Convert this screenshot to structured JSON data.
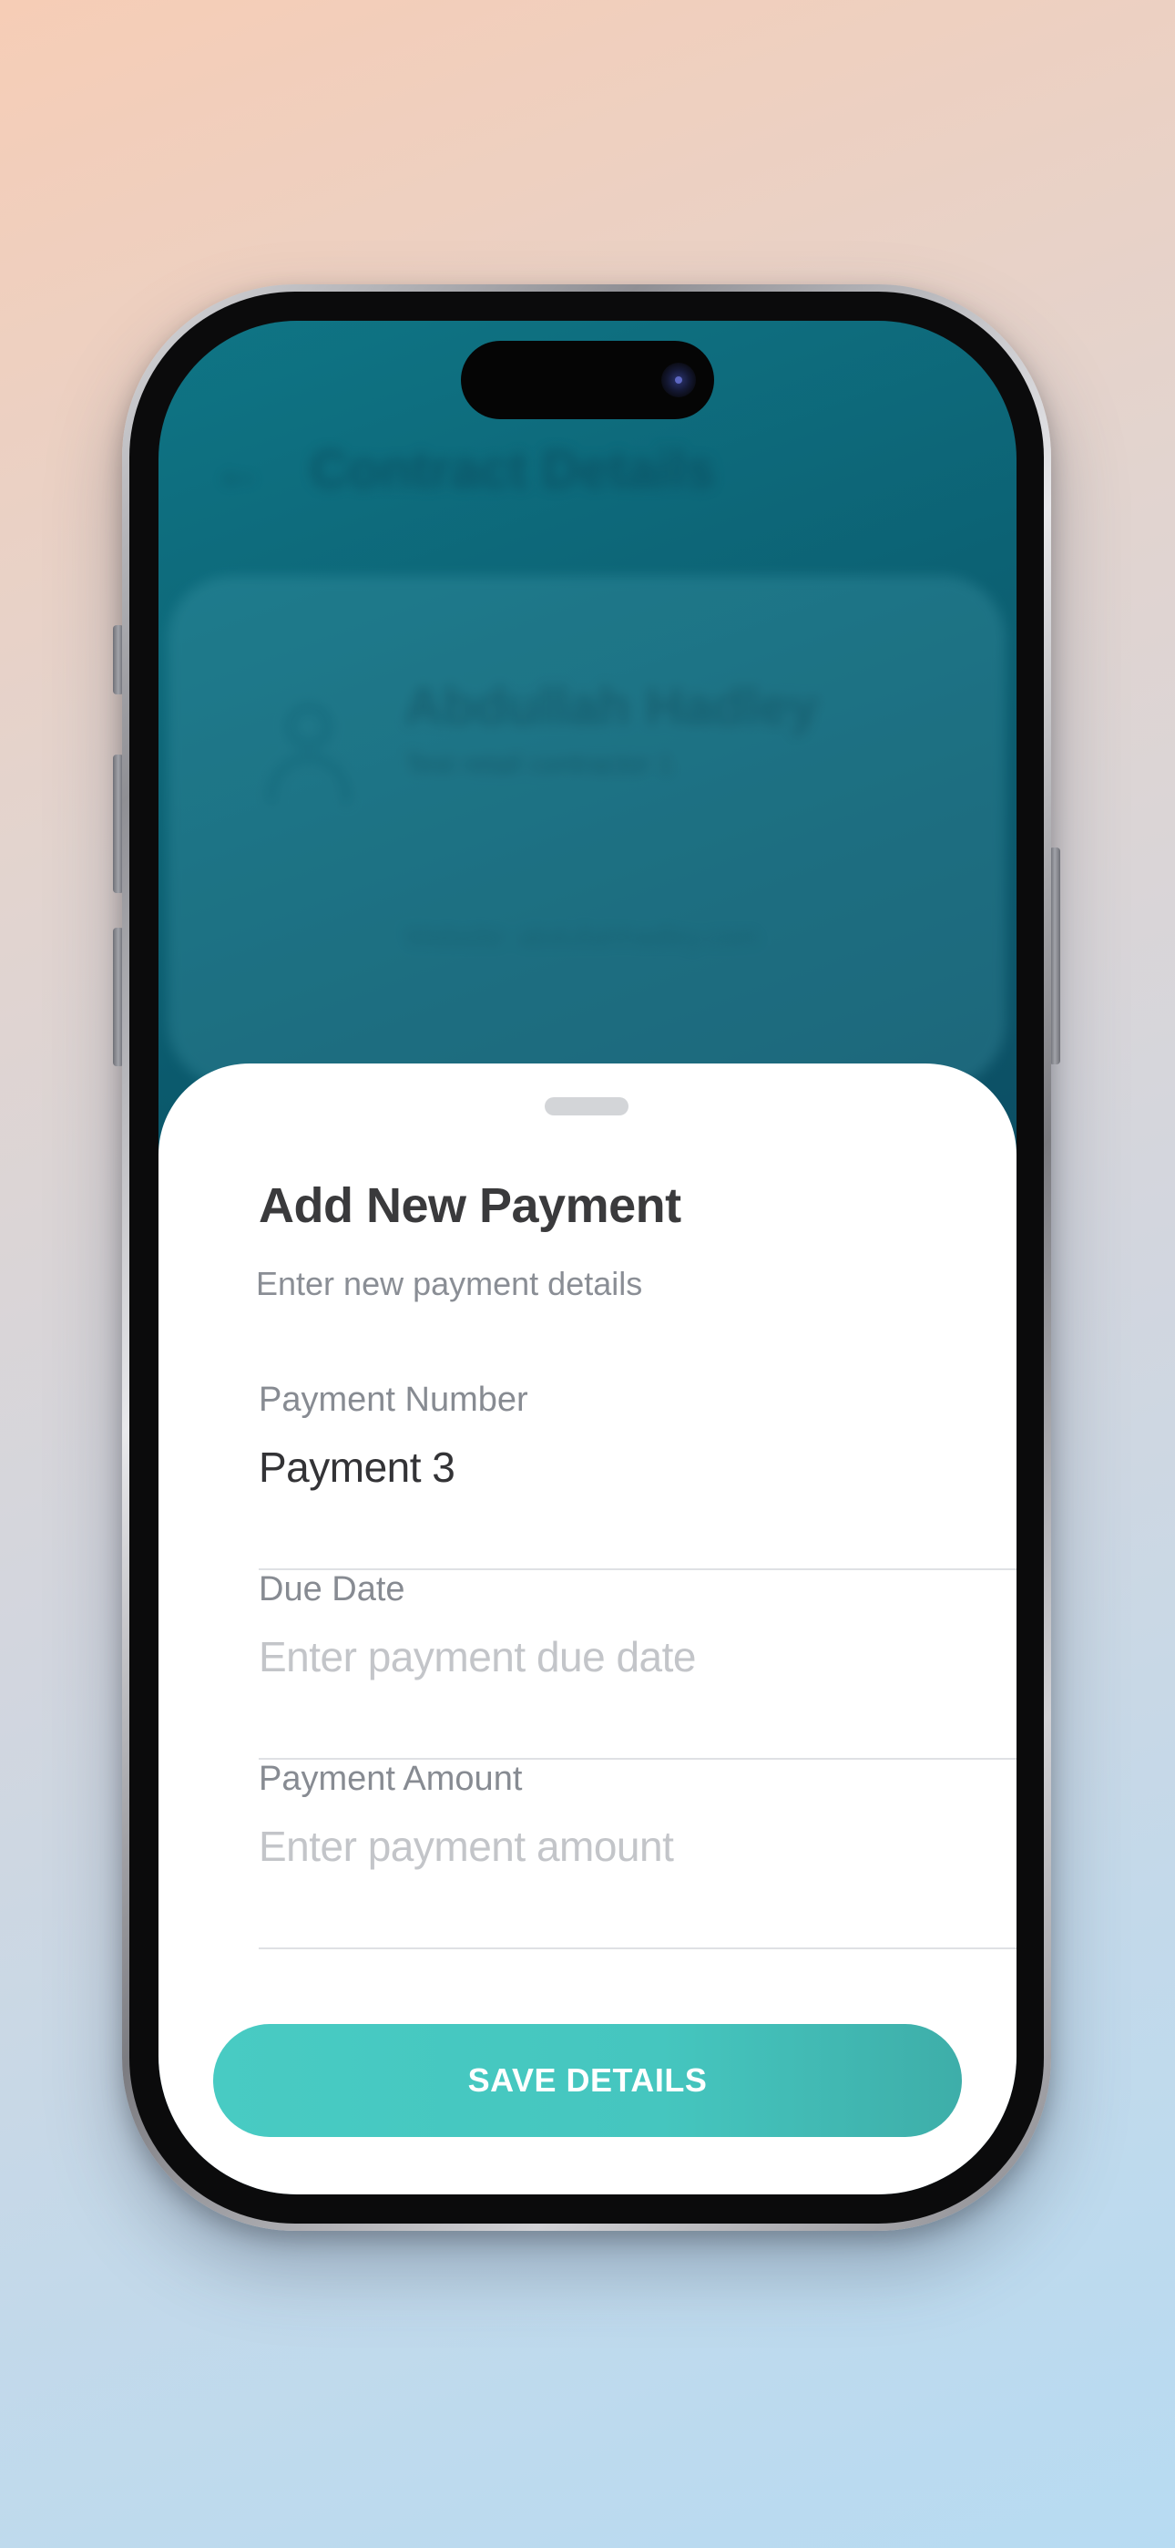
{
  "background_app": {
    "back_icon": "arrow-left-icon",
    "title": "Contract Details",
    "card_name": "Abdullah Hadley",
    "card_subtitle": "Test retail contractor 1",
    "card_line": "Website: abdullahhadley.com"
  },
  "sheet": {
    "title": "Add New Payment",
    "subtitle": "Enter new payment details",
    "fields": [
      {
        "label": "Payment Number",
        "value": "Payment 3",
        "placeholder": ""
      },
      {
        "label": "Due Date",
        "value": "",
        "placeholder": "Enter payment due date"
      },
      {
        "label": "Payment Amount",
        "value": "",
        "placeholder": "Enter payment amount"
      }
    ],
    "save_label": "SAVE DETAILS"
  },
  "colors": {
    "accent": "#48cbc3",
    "screen_bg": "#0b5a6d"
  }
}
